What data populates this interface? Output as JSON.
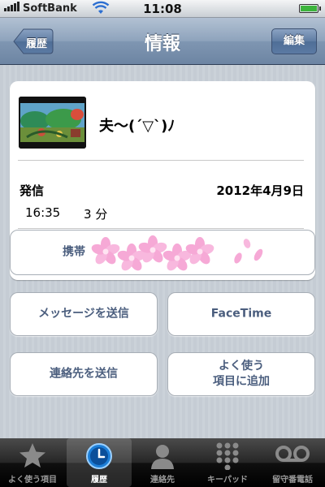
{
  "status_bar": {
    "carrier": "SoftBank",
    "time": "11:08"
  },
  "nav": {
    "title": "情報",
    "back_label": "履歴",
    "edit_label": "編集"
  },
  "contact": {
    "name": "夫〜(´▽`)ﾉ"
  },
  "call": {
    "type": "発信",
    "date": "2012年4月9日",
    "time": "16:35",
    "duration": "3 分"
  },
  "buttons": {
    "mobile_label": "携帯",
    "send_message": "メッセージを送信",
    "facetime": "FaceTime",
    "send_contact": "連絡先を送信",
    "add_favorites": "よく使う\n項目に追加"
  },
  "tabs": [
    {
      "label": "よく使う項目",
      "icon": "star-icon"
    },
    {
      "label": "履歴",
      "icon": "clock-icon"
    },
    {
      "label": "連絡先",
      "icon": "person-icon"
    },
    {
      "label": "キーパッド",
      "icon": "keypad-icon"
    },
    {
      "label": "留守番電話",
      "icon": "voicemail-icon"
    }
  ],
  "active_tab": 1,
  "colors": {
    "nav_bar": "#8ea3bc",
    "background": "#c5ccd4",
    "button_text": "#4b5e7e",
    "sticker_pink": "#f6a9d6"
  }
}
